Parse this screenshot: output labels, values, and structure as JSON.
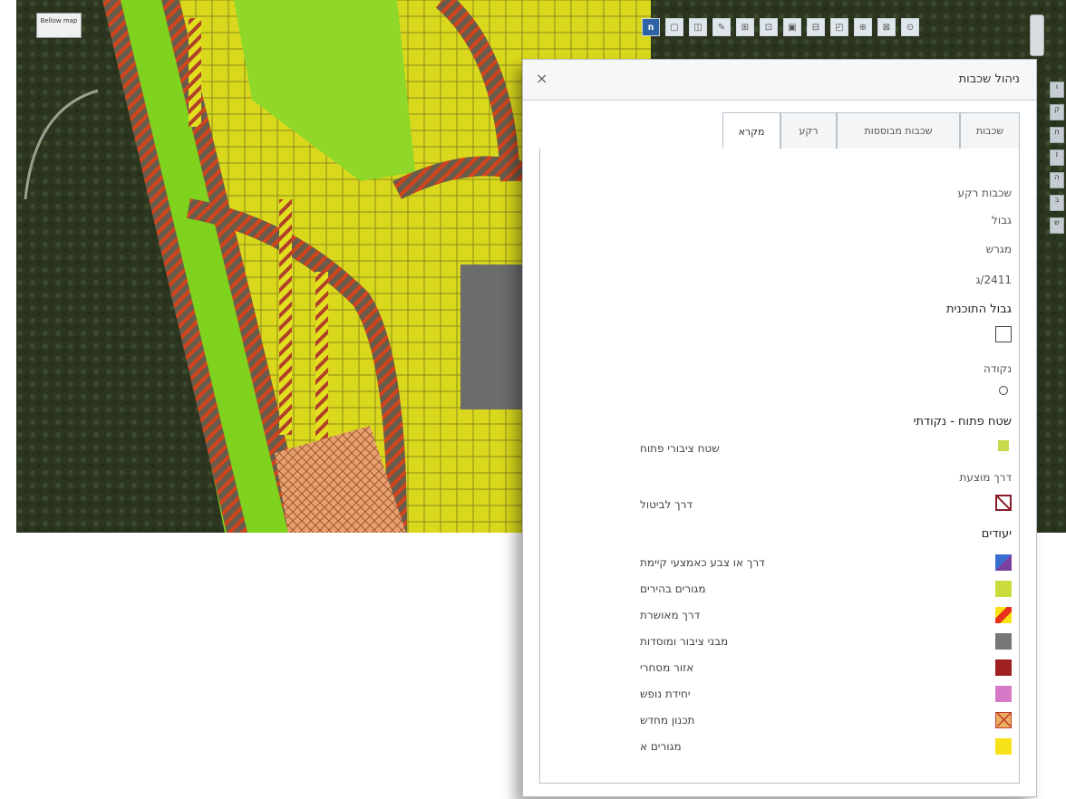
{
  "map": {
    "thumbnail_label": "Bellow map",
    "tools": [
      {
        "icon": "home-icon",
        "glyph": "ח"
      },
      {
        "icon": "tool-icon",
        "glyph": "▢"
      },
      {
        "icon": "tool-icon",
        "glyph": "◫"
      },
      {
        "icon": "tool-icon",
        "glyph": "✎"
      },
      {
        "icon": "tool-icon",
        "glyph": "⊞"
      },
      {
        "icon": "tool-icon",
        "glyph": "⊡"
      },
      {
        "icon": "tool-icon",
        "glyph": "▣"
      },
      {
        "icon": "tool-icon",
        "glyph": "⊟"
      },
      {
        "icon": "tool-icon",
        "glyph": "◰"
      },
      {
        "icon": "tool-icon",
        "glyph": "⊕"
      },
      {
        "icon": "tool-icon",
        "glyph": "⊠"
      },
      {
        "icon": "tool-icon",
        "glyph": "⊙"
      }
    ],
    "side_tabs": [
      "ו",
      "ק",
      "ת",
      "ז",
      "ה",
      "ב",
      "ש"
    ]
  },
  "dialog": {
    "title": "ניהול שכבות",
    "close": "×",
    "tabs": [
      {
        "label": "שכבות"
      },
      {
        "label": "שכבות מבוססות"
      },
      {
        "label": "רקע"
      },
      {
        "label": "מקרא",
        "active": true
      }
    ],
    "legend": {
      "section_title": "שכבות רקע",
      "lines": [
        "גבול",
        "מגרש",
        "2411/ג"
      ],
      "plan_boundary_label": "גבול התוכנית",
      "point_label": "נקודה",
      "open_area_label": "שטח פתוח - נקודתי",
      "open_area_text": "שטח ציבורי פתוח",
      "roads_label": "דרך מוצעת",
      "proposed_road_text": "דרך לביטול",
      "uses_label": "יעודים",
      "items": [
        {
          "text": "דרך או צבע כאמצעי קיימת",
          "color": "#7b3fa0",
          "pattern": "split"
        },
        {
          "text": "מגורים בהירים",
          "color": "#c9dc3c",
          "pattern": "solid"
        },
        {
          "text": "דרך מאושרת",
          "color": "#e8301a",
          "pattern": "stripe"
        },
        {
          "text": "מבני ציבור ומוסדות",
          "color": "#777777",
          "pattern": "solid"
        },
        {
          "text": "אזור מסחרי",
          "color": "#a02020",
          "pattern": "solid"
        },
        {
          "text": "יחידת נופש",
          "color": "#d67ac8",
          "pattern": "solid"
        },
        {
          "text": "תכנון מחדש",
          "color": "#e8b060",
          "pattern": "cross"
        },
        {
          "text": "מגורים א",
          "color": "#f7e21a",
          "pattern": "solid"
        }
      ]
    }
  }
}
